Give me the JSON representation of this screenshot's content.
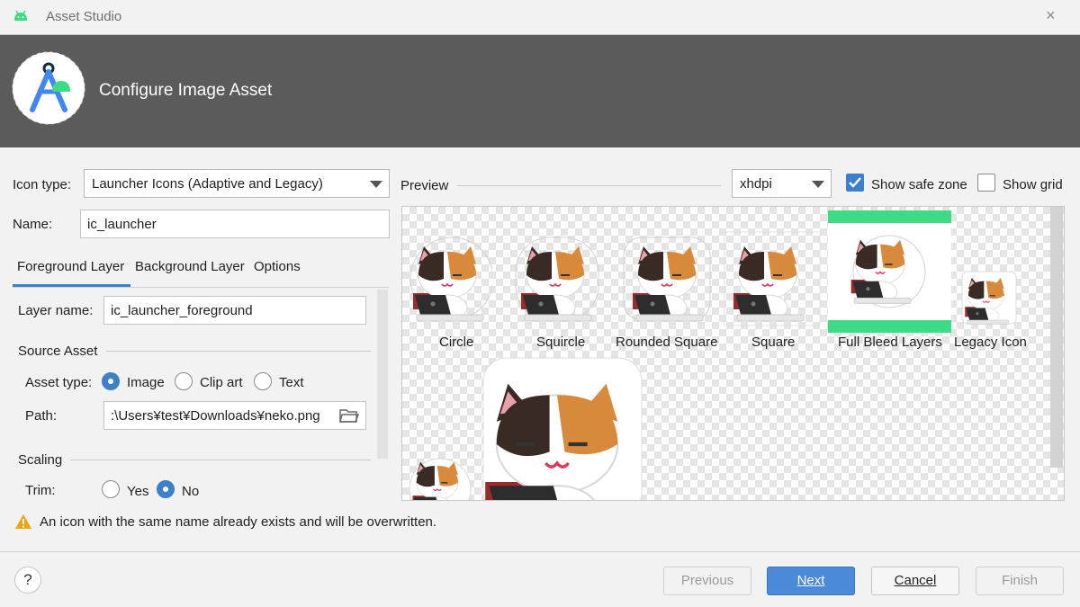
{
  "window": {
    "title": "Asset Studio",
    "close_glyph": "×"
  },
  "header": {
    "title": "Configure Image Asset"
  },
  "form": {
    "icon_type": {
      "label": "Icon type:",
      "value": "Launcher Icons (Adaptive and Legacy)"
    },
    "name": {
      "label": "Name:",
      "value": "ic_launcher"
    },
    "tabs": [
      {
        "label": "Foreground Layer",
        "selected": true
      },
      {
        "label": "Background Layer",
        "selected": false
      },
      {
        "label": "Options",
        "selected": false
      }
    ],
    "layer_name": {
      "label": "Layer name:",
      "value": "ic_launcher_foreground"
    },
    "source_asset": {
      "heading": "Source Asset",
      "asset_type_label": "Asset type:",
      "options": [
        {
          "label": "Image",
          "selected": true
        },
        {
          "label": "Clip art",
          "selected": false
        },
        {
          "label": "Text",
          "selected": false
        }
      ],
      "path_label": "Path:",
      "path_value": ":\\Users¥test¥Downloads¥neko.png"
    },
    "scaling": {
      "heading": "Scaling",
      "trim_label": "Trim:",
      "trim_options": [
        {
          "label": "Yes",
          "selected": false
        },
        {
          "label": "No",
          "selected": true
        }
      ]
    }
  },
  "preview": {
    "label": "Preview",
    "density": "xhdpi",
    "show_safe_zone": {
      "label": "Show safe zone",
      "checked": true
    },
    "show_grid": {
      "label": "Show grid",
      "checked": false
    },
    "icons": [
      "Circle",
      "Squircle",
      "Rounded Square",
      "Square",
      "Full Bleed Layers",
      "Legacy Icon"
    ]
  },
  "warning": {
    "text": "An icon with the same name already exists and will be overwritten."
  },
  "buttons": {
    "help": "?",
    "previous": "Previous",
    "next": "Next",
    "cancel": "Cancel",
    "finish": "Finish"
  },
  "colors": {
    "accent": "#3d7fc8",
    "banner": "#5b5b5b",
    "safe_zone": "#3ddc84"
  }
}
